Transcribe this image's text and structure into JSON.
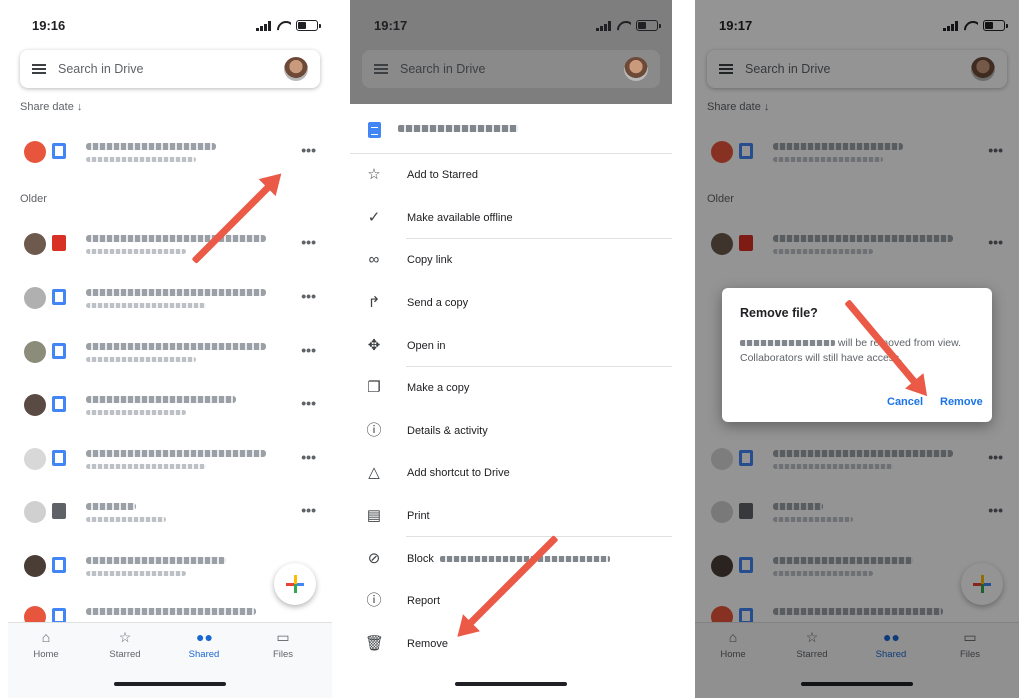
{
  "status": {
    "time1": "19:16",
    "time2": "19:17",
    "time3": "19:17"
  },
  "search": {
    "placeholder": "Search in Drive"
  },
  "list": {
    "sort_label": "Share date ↓",
    "older_label": "Older"
  },
  "nav": [
    {
      "label": "Home",
      "icon": "home-icon"
    },
    {
      "label": "Starred",
      "icon": "star-icon"
    },
    {
      "label": "Shared",
      "icon": "people-icon",
      "active": true
    },
    {
      "label": "Files",
      "icon": "folder-icon"
    }
  ],
  "menu": {
    "items": [
      {
        "label": "Add to Starred",
        "icon": "star-outline-icon"
      },
      {
        "label": "Make available offline",
        "icon": "offline-check-icon"
      },
      {
        "label": "Copy link",
        "icon": "link-icon"
      },
      {
        "label": "Send a copy",
        "icon": "share-arrow-icon"
      },
      {
        "label": "Open in",
        "icon": "move-arrows-icon"
      },
      {
        "label": "Make a copy",
        "icon": "copy-icon"
      },
      {
        "label": "Details & activity",
        "icon": "info-icon"
      },
      {
        "label": "Add shortcut to Drive",
        "icon": "shortcut-icon"
      },
      {
        "label": "Print",
        "icon": "print-icon"
      },
      {
        "label": "Block",
        "icon": "block-icon"
      },
      {
        "label": "Report",
        "icon": "report-icon"
      },
      {
        "label": "Remove",
        "icon": "trash-icon"
      }
    ]
  },
  "dialog": {
    "title": "Remove file?",
    "body_end": "will be removed from view. Collaborators will still have access.",
    "cancel": "Cancel",
    "confirm": "Remove"
  },
  "colors": {
    "accent": "#1a73e8",
    "arrow": "#ea5a47",
    "dim": "#7e7e7e"
  }
}
